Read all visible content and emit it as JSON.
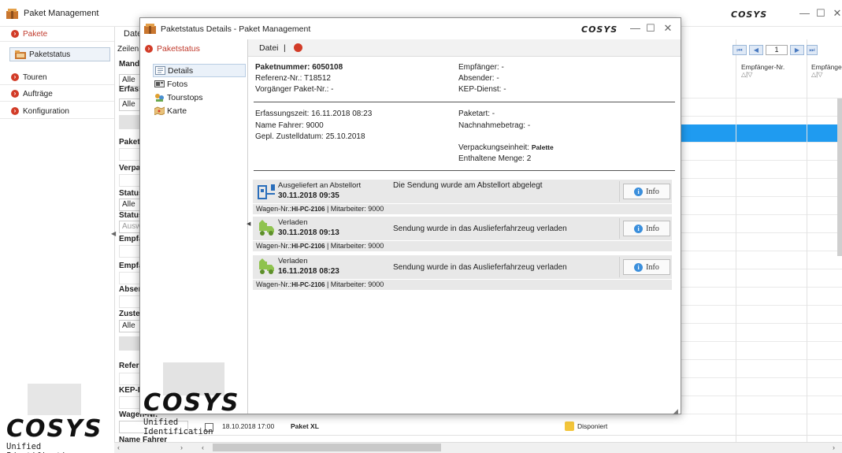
{
  "main_window": {
    "title": "Paket Management",
    "logo_text": "COSYS",
    "controls": {
      "minimize": "—",
      "maximize": "☐",
      "close": "✕"
    }
  },
  "left_nav": {
    "items": [
      {
        "label": "Pakete",
        "icon": "red-circle-icon"
      },
      {
        "label": "Paketstatus",
        "icon": "folder-icon"
      },
      {
        "label": "Touren",
        "icon": "red-circle-icon"
      },
      {
        "label": "Aufträge",
        "icon": "red-circle-icon"
      },
      {
        "label": "Konfiguration",
        "icon": "red-circle-icon"
      }
    ],
    "logo_caption": "Unified Identification"
  },
  "filter_panel": {
    "tab": "Date",
    "zeilen": "Zeilen",
    "labels": {
      "mand": "Mand",
      "erfass": "Erfass",
      "paket": "Paket",
      "verpa": "Verpa",
      "status1": "Status",
      "status2": "Status",
      "empf1": "Empfä",
      "empf2": "Empfä",
      "absen": "Absen",
      "zuste": "Zuste",
      "refer": "Refer",
      "kep": "KEP-D",
      "wagen": "Wagen-Nr.",
      "fahrer": "Name Fahrer"
    },
    "selects": {
      "mand": "Alle",
      "erfass": "Alle",
      "status1": "Alle",
      "status2": "Ausw",
      "zuste": "Alle"
    }
  },
  "grid": {
    "pager_page": "1",
    "headers": {
      "empfaenger_nr": "Empfänger-Nr.",
      "empfaenger": "Empfänge"
    },
    "sort_glyph": "△|▽",
    "bottom_row": {
      "date": "18.10.2018 17:00",
      "product": "Paket XL",
      "status": "Disponiert"
    }
  },
  "modal": {
    "title": "Paketstatus Details - Paket Management",
    "logo_text": "COSYS",
    "sidebar": {
      "header": "Paketstatus",
      "items": [
        {
          "label": "Details",
          "icon": "details-icon"
        },
        {
          "label": "Fotos",
          "icon": "photos-icon"
        },
        {
          "label": "Tourstops",
          "icon": "tourstops-icon"
        },
        {
          "label": "Karte",
          "icon": "map-icon"
        }
      ],
      "logo_caption": "Unified Identification"
    },
    "toolbar": {
      "datei": "Datei",
      "separator": "|"
    },
    "info": {
      "paketnummer": "Paketnummer: 6050108",
      "referenz": "Referenz-Nr.: T18512",
      "vorgaenger": "Vorgänger Paket-Nr.: -",
      "empfaenger": "Empfänger: -",
      "absender": "Absender: -",
      "kep": "KEP-Dienst: -",
      "erfassungszeit": "Erfassungszeit: 16.11.2018 08:23",
      "fahrer": "Name Fahrer: 9000",
      "zustelldatum": "Gepl. Zustelldatum: 25.10.2018",
      "paketart": "Paketart: -",
      "nachnahme": "Nachnahmebetrag: -",
      "verpackung_label": "Verpackungseinheit:",
      "verpackung_value": "Palette",
      "menge": "Enthaltene Menge: 2"
    },
    "events": [
      {
        "title": "Ausgeliefert an Abstellort",
        "date": "30.11.2018 09:35",
        "description": "Die Sendung wurde am Abstellort abgelegt",
        "meta_prefix": "Wagen-Nr.:",
        "meta_wagen": "HI-PC-2106",
        "meta_suffix": " | Mitarbeiter: 9000",
        "button": "Info",
        "icon": "delivery-point-icon"
      },
      {
        "title": "Verladen",
        "date": "30.11.2018 09:13",
        "description": "Sendung wurde in das Auslieferfahrzeug verladen",
        "meta_prefix": "Wagen-Nr.:",
        "meta_wagen": "HI-PC-2106",
        "meta_suffix": " | Mitarbeiter: 9000",
        "button": "Info",
        "icon": "loaded-truck-icon"
      },
      {
        "title": "Verladen",
        "date": "16.11.2018 08:23",
        "description": "Sendung wurde in das Auslieferfahrzeug verladen",
        "meta_prefix": "Wagen-Nr.:",
        "meta_wagen": "HI-PC-2106",
        "meta_suffix": " | Mitarbeiter: 9000",
        "button": "Info",
        "icon": "loaded-truck-icon"
      }
    ],
    "info_glyph": "i"
  },
  "colors": {
    "accent_red": "#d23c28",
    "selection_blue": "#1f9bf0",
    "info_blue": "#3b8fdc"
  }
}
